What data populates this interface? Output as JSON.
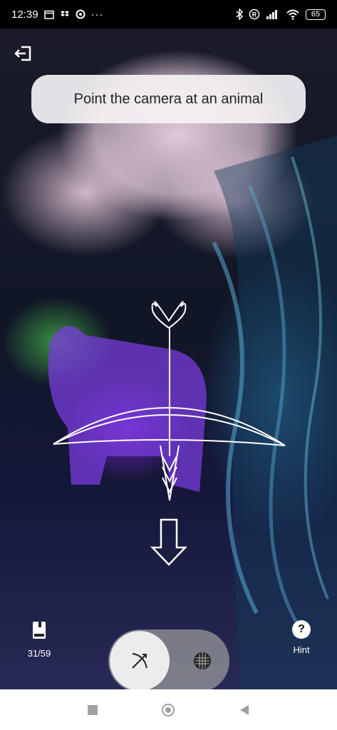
{
  "status_bar": {
    "time": "12:39",
    "left_icons": [
      "calendar-icon",
      "dropbox-icon",
      "app-icon",
      "more-icon"
    ],
    "right_icons": [
      "bluetooth-icon",
      "registered-icon",
      "signal-icon",
      "wifi-icon",
      "battery-icon"
    ],
    "battery": "65"
  },
  "prompt": {
    "text": "Point the camera at an animal"
  },
  "collection": {
    "count": "31/59"
  },
  "hint": {
    "symbol": "?",
    "label": "Hint"
  },
  "mode_toggle": {
    "selected": "bow-arrow",
    "other": "net"
  },
  "nav_bar": {
    "buttons": [
      "recents",
      "home",
      "back"
    ]
  },
  "colors": {
    "prompt_bg": "#f5f2f5",
    "toggle_knob": "#ececec",
    "toggle_track": "#a0a0a0"
  }
}
